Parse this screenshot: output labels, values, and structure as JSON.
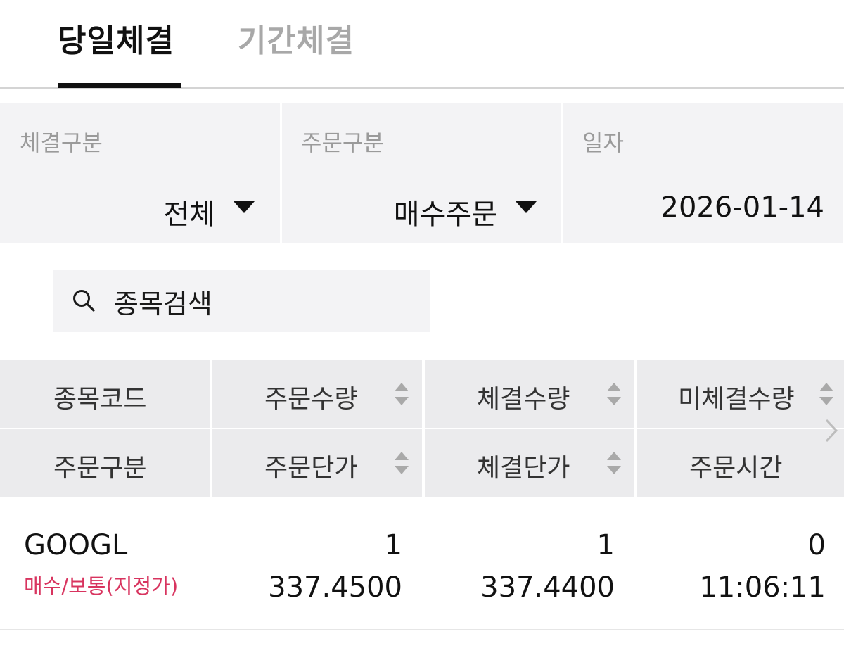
{
  "tabs": [
    {
      "label": "당일체결",
      "active": true
    },
    {
      "label": "기간체결",
      "active": false
    }
  ],
  "filters": {
    "execution_type": {
      "label": "체결구분",
      "value": "전체"
    },
    "order_type": {
      "label": "주문구분",
      "value": "매수주문"
    },
    "date": {
      "label": "일자",
      "value": "2026-01-14"
    }
  },
  "search": {
    "placeholder": "종목검색",
    "icon": "search-icon"
  },
  "table": {
    "headers_row1": [
      "종목코드",
      "주문수량",
      "체결수량",
      "미체결수량"
    ],
    "headers_row2": [
      "주문구분",
      "주문단가",
      "체결단가",
      "주문시간"
    ],
    "rows": [
      {
        "code": "GOOGL",
        "order_type": "매수/보통(지정가)",
        "order_qty": "1",
        "exec_qty": "1",
        "unexec_qty": "0",
        "order_price": "337.4500",
        "exec_price": "337.4400",
        "order_time": "11:06:11"
      }
    ]
  },
  "colors": {
    "accent_text": "#111111",
    "inactive_tab": "#a8a8a8",
    "buy_order": "#d8345f",
    "panel_bg": "#f3f3f5",
    "header_bg": "#ebebed"
  }
}
